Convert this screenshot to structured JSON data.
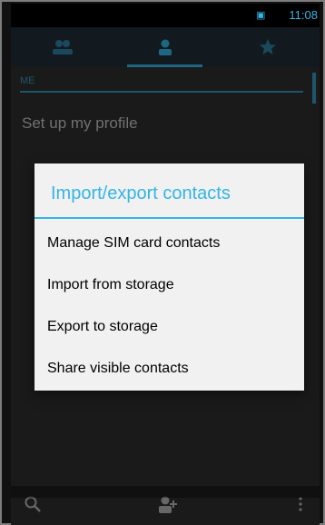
{
  "status": {
    "time": "11:08"
  },
  "tabs": [
    {
      "name": "groups"
    },
    {
      "name": "all-contacts"
    },
    {
      "name": "favorites"
    }
  ],
  "list": {
    "me_header": "ME",
    "setup_profile": "Set up my profile"
  },
  "dialog": {
    "title": "Import/export contacts",
    "items": [
      "Manage SIM card contacts",
      "Import from storage",
      "Export to storage",
      "Share visible contacts"
    ]
  },
  "colors": {
    "accent": "#33b5e5",
    "dialog_bg": "#f1f1f1"
  },
  "icons": [
    "status-icon",
    "groups-icon",
    "person-icon",
    "star-icon",
    "search-icon",
    "add-contact-icon",
    "overflow-menu-icon"
  ]
}
